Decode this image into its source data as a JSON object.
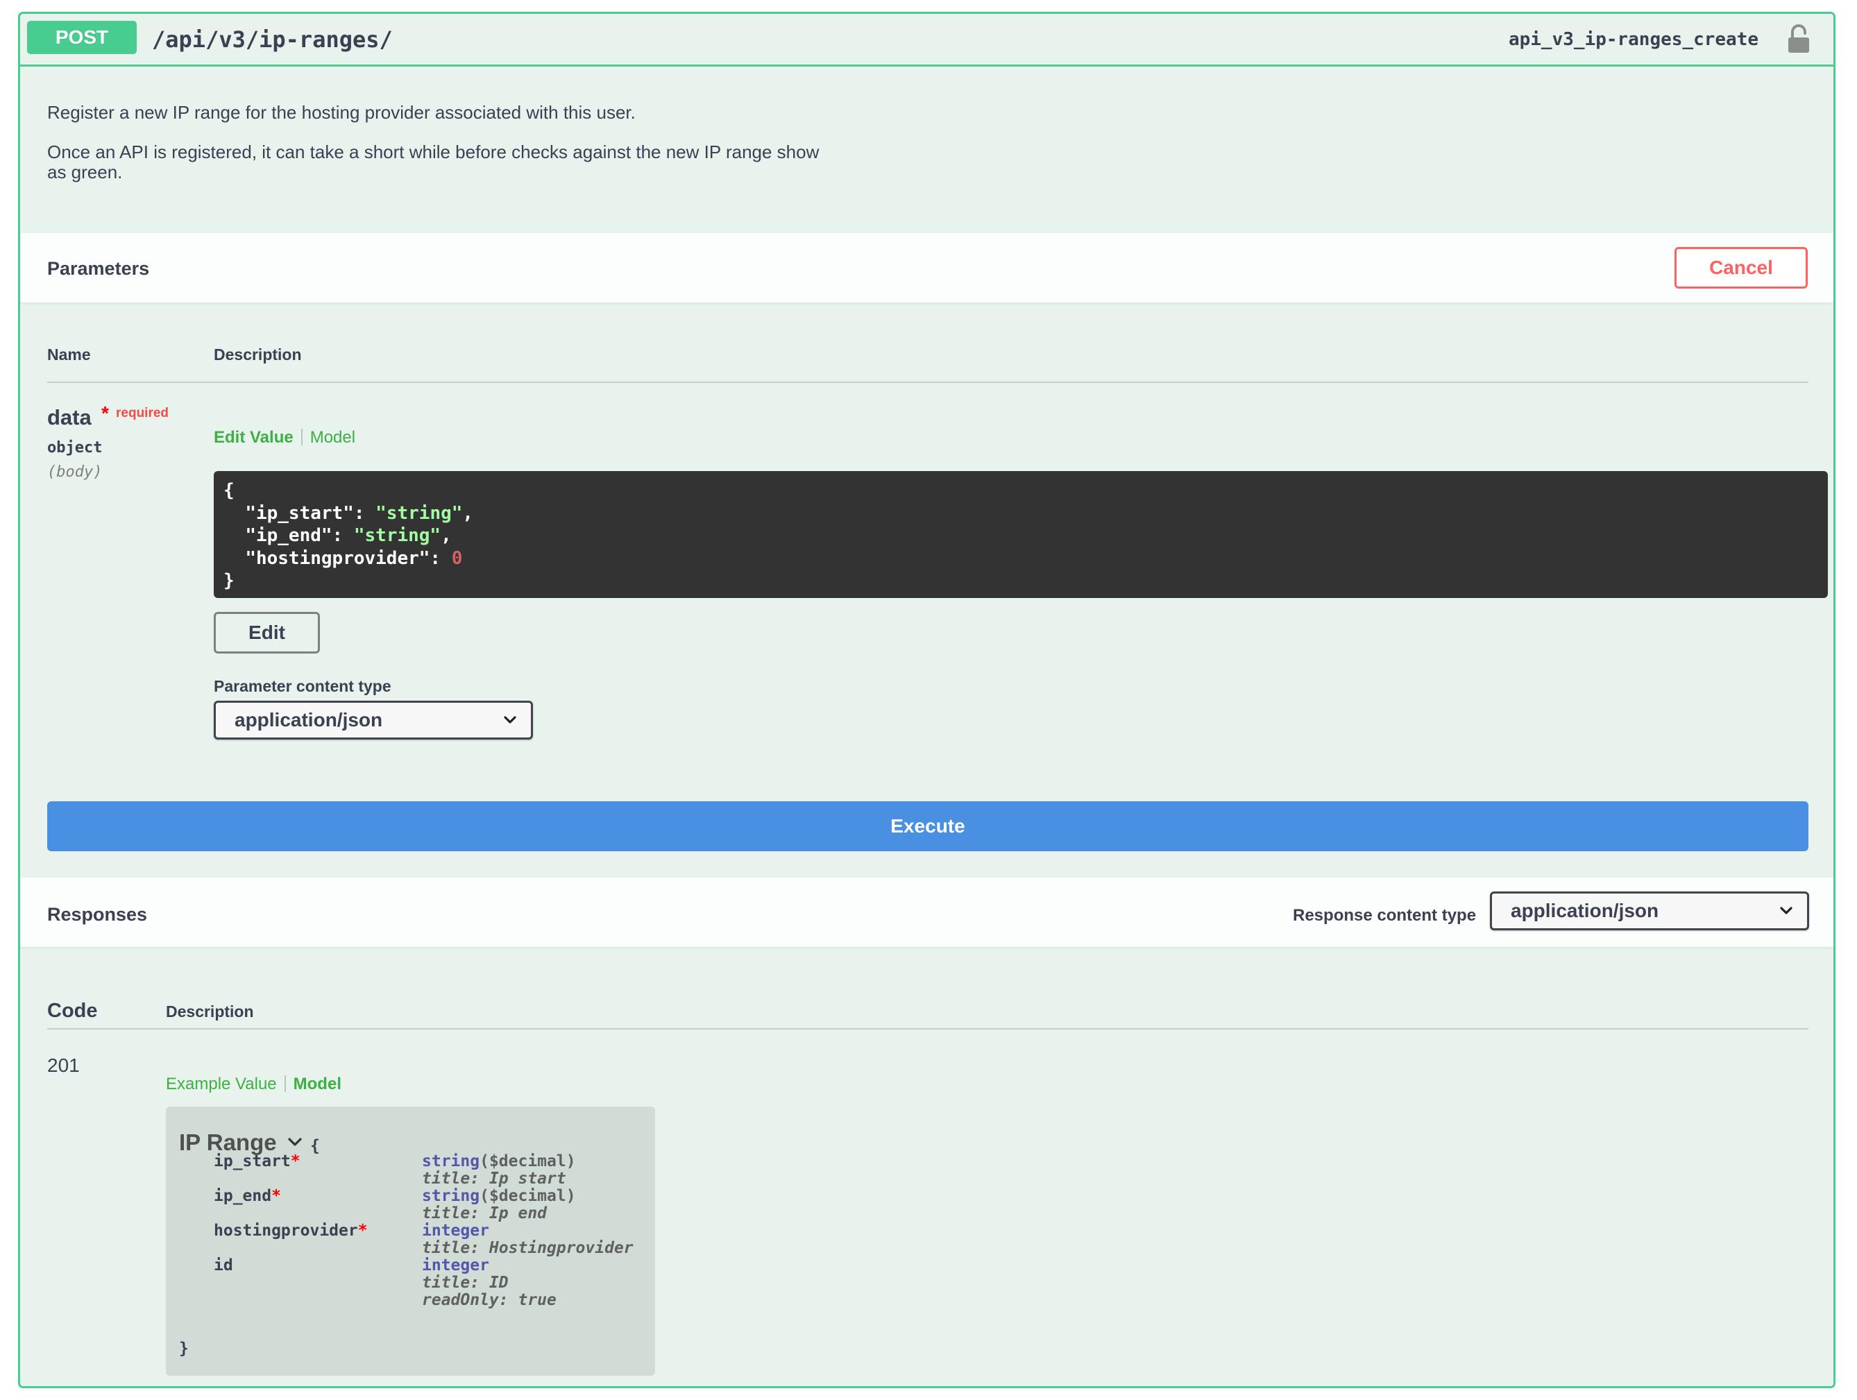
{
  "summary": {
    "method": "POST",
    "path": "/api/v3/ip-ranges/",
    "operation_id": "api_v3_ip-ranges_create"
  },
  "description": {
    "para1": "Register a new IP range for the hosting provider associated with this user.",
    "para2": "Once an API is registered, it can take a short while before checks against the new IP range show as green."
  },
  "parameters": {
    "title": "Parameters",
    "cancel_label": "Cancel",
    "col_name": "Name",
    "col_description": "Description",
    "param": {
      "name": "data",
      "star": "*",
      "required": "required",
      "type": "object",
      "in": "(body)"
    },
    "tabs": {
      "edit_value": "Edit Value",
      "model": "Model"
    },
    "body_json": {
      "open": "{",
      "close": "}",
      "fields": [
        {
          "key": "\"ip_start\"",
          "value": "\"string\"",
          "kind": "string",
          "trail": ","
        },
        {
          "key": "\"ip_end\"",
          "value": "\"string\"",
          "kind": "string",
          "trail": ","
        },
        {
          "key": "\"hostingprovider\"",
          "value": "0",
          "kind": "number",
          "trail": ""
        }
      ]
    },
    "edit_label": "Edit",
    "content_type_label": "Parameter content type",
    "content_type_value": "application/json"
  },
  "execute_label": "Execute",
  "responses": {
    "title": "Responses",
    "content_type_label": "Response content type",
    "content_type_value": "application/json",
    "col_code": "Code",
    "col_description": "Description",
    "code": "201",
    "tabs": {
      "example_value": "Example Value",
      "model": "Model"
    },
    "model": {
      "name": "IP Range",
      "open": "{",
      "close": "}",
      "props": [
        {
          "name": "ip_start",
          "required": "*",
          "type": "string",
          "format": "($decimal)",
          "meta": [
            "title: Ip start"
          ]
        },
        {
          "name": "ip_end",
          "required": "*",
          "type": "string",
          "format": "($decimal)",
          "meta": [
            "title: Ip end"
          ]
        },
        {
          "name": "hostingprovider",
          "required": "*",
          "type": "integer",
          "format": "",
          "meta": [
            "title: Hostingprovider"
          ]
        },
        {
          "name": "id",
          "required": "",
          "type": "integer",
          "format": "",
          "meta": [
            "title: ID",
            "readOnly: true"
          ]
        }
      ]
    }
  },
  "icons": {
    "lock": "lock-icon",
    "chevron": "chevron-down-icon"
  },
  "colors": {
    "post": "#49cc90",
    "execute": "#4990e2",
    "cancel": "#ff6060",
    "background": "#e8f3ee"
  }
}
